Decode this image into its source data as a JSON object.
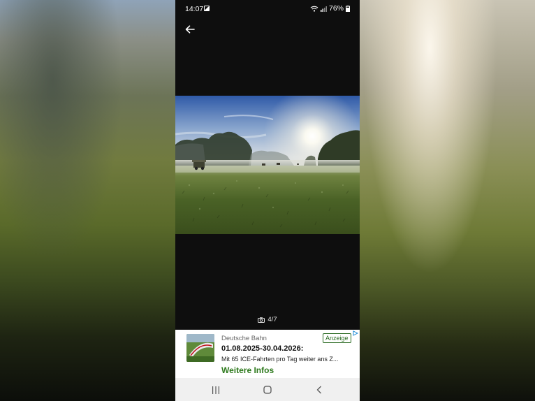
{
  "status_bar": {
    "time": "14:07",
    "battery": "76%",
    "icons": [
      "gallery-icon",
      "wifi-icon",
      "signal-icon",
      "battery-icon"
    ]
  },
  "viewer": {
    "back_icon": "arrow-left-icon",
    "counter": "4/7",
    "counter_icon": "camera-icon",
    "photo_description_icon": "landscape-photo"
  },
  "ad": {
    "brand": "Deutsche Bahn",
    "badge": "Anzeige",
    "title": "01.08.2025-30.04.2026:",
    "text": "Mit 65 ICE-Fahrten pro Tag weiter ans Z...",
    "cta": "Weitere Infos",
    "accent_color": "#2f7a1e"
  },
  "nav_bar": {
    "icons": [
      "recent-apps-icon",
      "home-icon",
      "back-nav-icon"
    ]
  }
}
